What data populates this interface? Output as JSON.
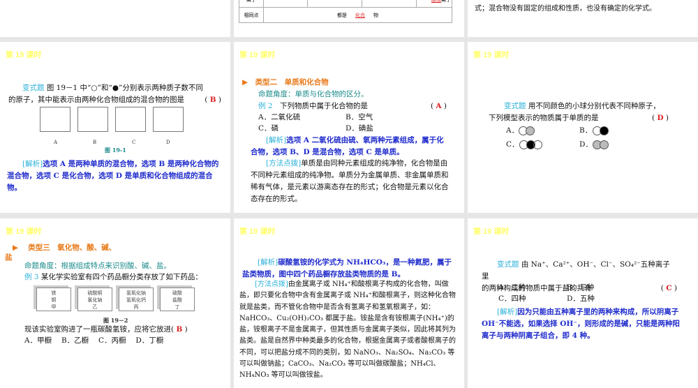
{
  "header": "第 19 课时",
  "top": {
    "table": {
      "row_label_ion": "离子",
      "acid_root": "酸根",
      "ion_suffix": "离子",
      "common_label": "相同点",
      "common_prefix": "都是",
      "common_answer": "化合",
      "common_suffix": "物"
    },
    "right_text": "式；混合物没有固定的组成和性质，也没有确定的化学式。"
  },
  "s1": {
    "tag": "变式题",
    "q1": "图 19－1 中“○”和“●”分别表示两种质子数不同",
    "q2": "的原子，其中能表示由两种化合物组成的混合物的图是",
    "answer": "B",
    "options": [
      "A",
      "B",
      "C",
      "D"
    ],
    "fig": "图 19-1",
    "jx_tag": "[解析]",
    "jx": "选项 A 是两种单质的混合物，选项 B 是两种化合物的混合物，选项 C 是化合物，选项 D 是单质和化合物组成的混合物。"
  },
  "s2": {
    "title": "类型二　单质和化合物",
    "angle": "命题角度：单质与化合物的区分。",
    "ex": "例 2",
    "q": "下列物质中属于化合物的是",
    "answer": "A",
    "opts": [
      "A．二氧化硫",
      "B．空气",
      "C．磷",
      "D．碘盐"
    ],
    "jx_tag": "[解析]",
    "jx": "选项 A 二氧化硫由硫、氧两种元素组成，属于化合物，选项 B、D 是混合物，选项 C 是单质。",
    "ff_tag": "[方法点拨]",
    "ff": "单质是由同种元素组成的纯净物，化合物是由不同种元素组成的纯净物。单质分为金属单质、非金属单质和稀有气体，是元素以游离态存在的形式；化合物是元素以化合态存在的形式。"
  },
  "s3": {
    "tag": "变式题",
    "q1": "用不同颜色的小球分别代表不同种原子，",
    "q2": "下列模型表示的物质属于单质的是",
    "answer": "D",
    "opts": [
      "A．",
      "B．",
      "C．",
      "D．"
    ]
  },
  "s4": {
    "title": "类型三　氧化物、酸、碱、",
    "title2": "盐",
    "angle": "命题角度：根据组成特点来识别酸、碱、盐。",
    "ex": "例 3",
    "q": "某化学实验室有四个药品橱分类存放了如下药品：",
    "cabinets": [
      [
        "铁",
        "铜",
        "甲"
      ],
      [
        "硫酸铜",
        "氯化钠",
        "乙"
      ],
      [
        "氢氧化钠",
        "氢氧化钙",
        "丙"
      ],
      [
        "硫酸",
        "盐酸",
        "丁"
      ]
    ],
    "fig": "图 19－2",
    "q2": "现该实验室购进了一瓶碳酸氢铵，应将它放进(",
    "answer": "B",
    "q2end": ")",
    "opts": [
      "A．甲橱",
      "B．乙橱",
      "C．丙橱",
      "D．丁橱"
    ]
  },
  "s5": {
    "jx_tag": "[解析]",
    "jx": "碳酸氢铵的化学式为 NH₄HCO₃，是一种氮肥，属于盐类物质，图中四个药品橱存放盐类物质的是 B。",
    "ff_tag": "[方法点拨]",
    "ff": "由金属离子或 NH₄⁺和酸根离子构成的化合物，叫做盐，即只要化合物中含有金属离子或 NH₄⁺和酸根离子，则这种化合物就是盐类，而不管化合物中是否含有氢离子和氢氧根离子，如：NaHCO₃、Cu₂(OH)₂CO₃ 都属于盐。铵盐是含有铵根离子(NH₄⁺)的盐，铵根离子不是金属离子，但其性质与金属离子类似，因此将其列为盐类。盐是自然界中种类最多的化合物，根据金属离子或者酸根离子的不同，可以把盐分成不同的类别，如 NaNO₃、Na₂SO₄、Na₂CO₃ 等可以叫做钠盐；CaCO₃、Na₂CO₃ 等可以叫做碳酸盐；NH₄Cl、NH₄NO₃ 等可以叫做铵盐。"
  },
  "s6": {
    "tag": "变式题",
    "q1": "由 Na⁺、Ca²⁺、OH⁻、Cl⁻、SO₄²⁻五种离子里",
    "q2": "的两种构成的物质中属于盐的共有",
    "answer": "C",
    "opts": [
      "A．二种",
      "B．三种",
      "C．四种",
      "D．五种"
    ],
    "jx_tag": "[解析]",
    "jx": "因为只能由五种离子里的两种来构成，所以阴离子 OH⁻不能选，如果选择 OH⁻，则形成的是碱，只能是两种阳离子与两种阴离子组合，即 4 种。"
  },
  "colors": {
    "header": "#ffff66",
    "cyan": "#2ab0d8",
    "blue": "#1f2bcc",
    "red": "#dd2222",
    "orange": "#e87a1a"
  }
}
